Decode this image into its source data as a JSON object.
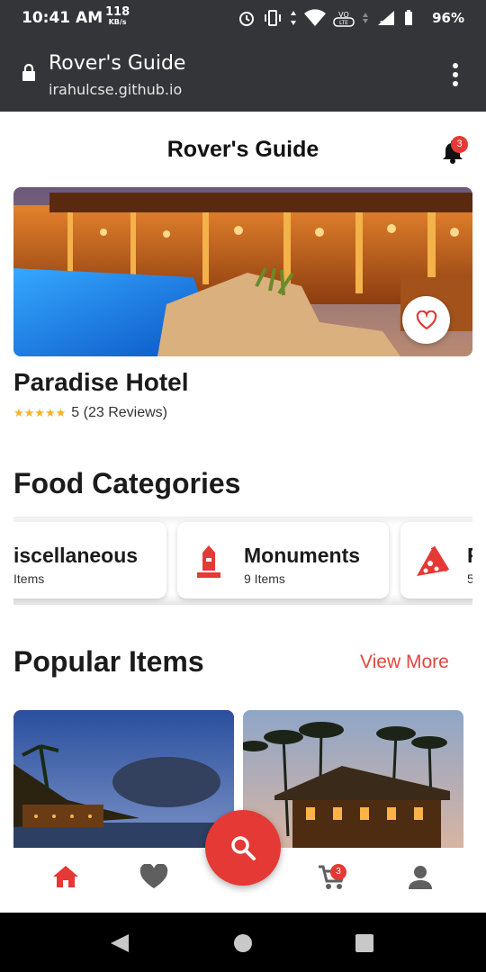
{
  "status_bar": {
    "time": "10:41 AM",
    "speed_value": "118",
    "speed_unit": "KB/s",
    "battery": "96%",
    "icons": [
      "alarm-icon",
      "vibrate-icon",
      "wifi-icon",
      "volte-icon",
      "signal-icon",
      "battery-icon"
    ]
  },
  "browser": {
    "page_title": "Rover's Guide",
    "url": "irahulcse.github.io"
  },
  "app": {
    "title": "Rover's Guide",
    "notification_count": "3"
  },
  "hotel": {
    "name": "Paradise Hotel",
    "rating_text": "5 (23 Reviews)",
    "stars": 5
  },
  "categories": {
    "title": "Food Categories",
    "items": [
      {
        "name": "iscellaneous",
        "count": "Items"
      },
      {
        "name": "Monuments",
        "count": "9 Items"
      },
      {
        "name": "F",
        "count": "5"
      }
    ]
  },
  "popular": {
    "title": "Popular Items",
    "view_more": "View More"
  },
  "cart": {
    "count": "3"
  },
  "colors": {
    "accent": "#e53935",
    "status_bar": "#333538",
    "text": "#1b1b1b"
  }
}
